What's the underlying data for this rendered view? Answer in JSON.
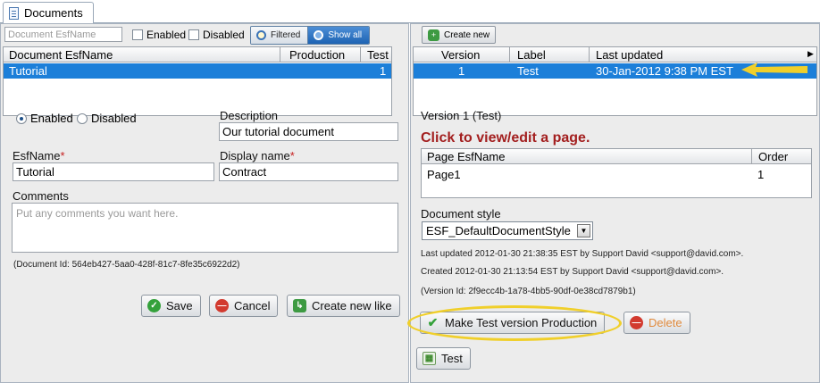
{
  "tab": {
    "label": "Documents"
  },
  "left": {
    "filter": {
      "placeholder": "Document EsfName"
    },
    "enabled_label": "Enabled",
    "disabled_label": "Disabled",
    "filtered_label": "Filtered",
    "show_all_label": "Show all",
    "grid": {
      "headers": [
        "Document EsfName",
        "Production",
        "Test"
      ],
      "rows": [
        {
          "name": "Tutorial",
          "production": "",
          "test": "1"
        }
      ]
    },
    "form": {
      "enabled_radio": "Enabled",
      "disabled_radio": "Disabled",
      "description_label": "Description",
      "description_value": "Our tutorial document",
      "esfname_label": "EsfName",
      "esfname_value": "Tutorial",
      "display_name_label": "Display name",
      "display_name_value": "Contract",
      "required_mark": "*",
      "comments_label": "Comments",
      "comments_placeholder": "Put any comments you want here.",
      "document_id": "(Document Id: 564eb427-5aa0-428f-81c7-8fe35c6922d2)"
    },
    "buttons": {
      "save": "Save",
      "cancel": "Cancel",
      "create_new_like": "Create new like"
    }
  },
  "right": {
    "create_new_label": "Create new",
    "grid": {
      "headers": [
        "Version",
        "Label",
        "Last updated"
      ],
      "rows": [
        {
          "version": "1",
          "label": "Test",
          "last_updated": "30-Jan-2012 9:38 PM EST"
        }
      ]
    },
    "version_title": "Version 1 (Test)",
    "click_hint": "Click to view/edit a page.",
    "pages": {
      "headers": [
        "Page EsfName",
        "Order"
      ],
      "rows": [
        {
          "name": "Page1",
          "order": "1"
        }
      ]
    },
    "document_style_label": "Document style",
    "document_style_value": "ESF_DefaultDocumentStyle",
    "last_updated_text": "Last updated 2012-01-30 21:38:35 EST by Support David <support@david.com>.",
    "created_text": "Created 2012-01-30 21:13:54 EST by Support David <support@david.com>.",
    "version_id": "(Version Id: 2f9ecc4b-1a78-4bb5-90df-0e38cd7879b1)",
    "buttons": {
      "make_production": "Make Test version Production",
      "delete": "Delete",
      "test": "Test"
    }
  },
  "colors": {
    "selection": "#1c7fd9",
    "highlight": "#f0cf2a",
    "hint": "#a31f1f"
  }
}
